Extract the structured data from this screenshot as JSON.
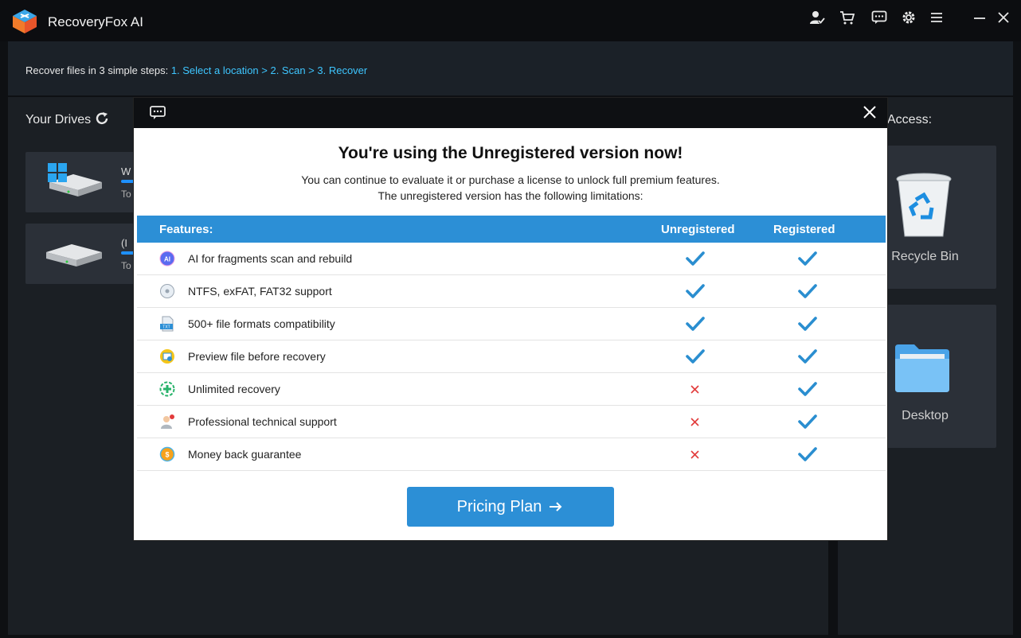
{
  "app": {
    "title": "RecoveryFox AI"
  },
  "titlebar": {
    "icons": [
      "account-icon",
      "cart-icon",
      "feedback-icon",
      "settings-icon",
      "menu-icon",
      "minimize-icon",
      "close-icon"
    ]
  },
  "steps": {
    "prefix": "Recover files in 3 simple steps:",
    "links": "1. Select a location > 2. Scan > 3. Recover",
    "link_color": "#3ec6ff"
  },
  "drives": {
    "title": "Your Drives",
    "items": [
      {
        "label": "W",
        "sub": "To"
      },
      {
        "label": "(I",
        "sub": "To"
      }
    ]
  },
  "quick_access": {
    "title": "Access:",
    "items": [
      {
        "label": "Recycle Bin",
        "icon": "recycle-bin-icon"
      },
      {
        "label": "Desktop",
        "icon": "folder-icon"
      }
    ]
  },
  "modal": {
    "title": "You're using the Unregistered version now!",
    "subtitle_line1": "You can continue to evaluate it or purchase a license to unlock full premium features.",
    "subtitle_line2": "The unregistered version has the following limitations:",
    "columns": {
      "features": "Features:",
      "unregistered": "Unregistered",
      "registered": "Registered"
    },
    "rows": [
      {
        "label": "AI for fragments scan and rebuild",
        "icon": "ai-icon",
        "unregistered": true,
        "registered": true
      },
      {
        "label": "NTFS, exFAT, FAT32 support",
        "icon": "disk-icon",
        "unregistered": true,
        "registered": true
      },
      {
        "label": "500+ file formats compatibility",
        "icon": "txt-file-icon",
        "unregistered": true,
        "registered": true
      },
      {
        "label": "Preview file before recovery",
        "icon": "preview-icon",
        "unregistered": true,
        "registered": true
      },
      {
        "label": "Unlimited recovery",
        "icon": "plus-circle-icon",
        "unregistered": false,
        "registered": true
      },
      {
        "label": "Professional technical support",
        "icon": "support-agent-icon",
        "unregistered": false,
        "registered": true
      },
      {
        "label": "Money back guarantee",
        "icon": "coin-icon",
        "unregistered": false,
        "registered": true
      }
    ],
    "button": "Pricing Plan",
    "accent_color": "#2c8fd6",
    "check_color": "#2a8ed0",
    "cross_color": "#e23b3b"
  }
}
